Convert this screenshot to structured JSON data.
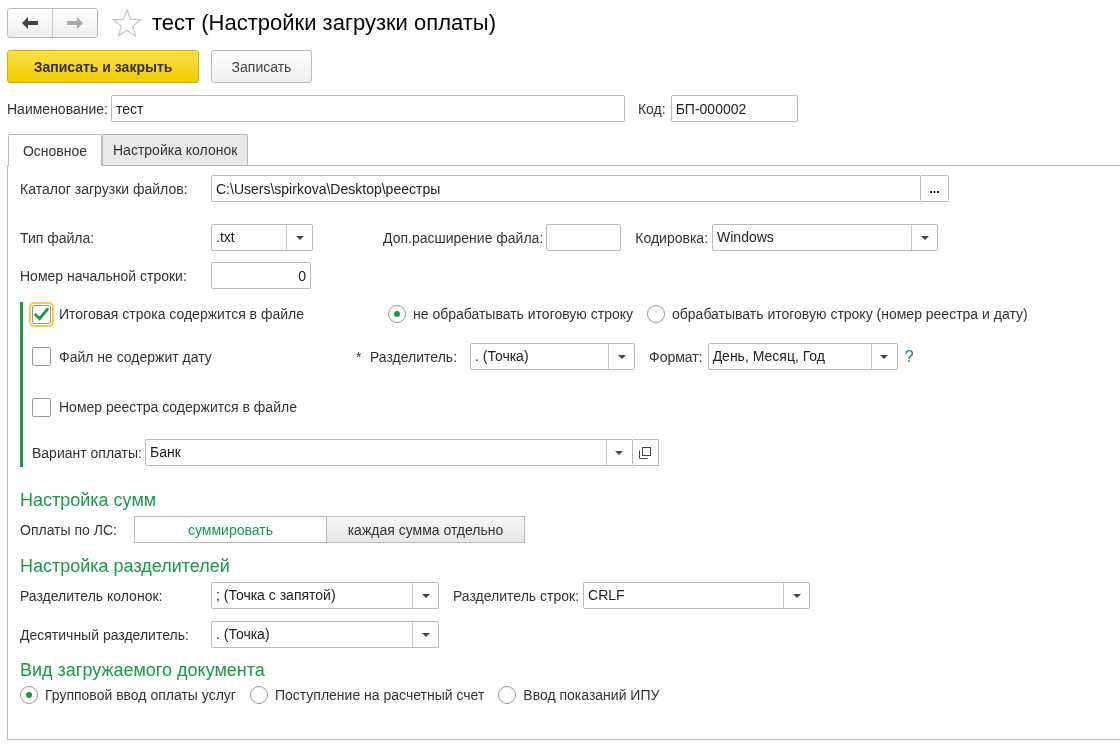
{
  "nav_buttons": [
    {
      "kind": "back",
      "disabled": false
    },
    {
      "kind": "forward",
      "disabled": true
    }
  ],
  "favorite": false,
  "window": {
    "title": "тест (Настройки загрузки оплаты)"
  },
  "toolbar": [
    {
      "label": "Записать и закрыть",
      "kind": "primary"
    },
    {
      "label": "Записать",
      "kind": "normal"
    }
  ],
  "header": {
    "name": {
      "label": "Наименование:",
      "value": "тест"
    },
    "code": {
      "label": "Код:",
      "value": "БП-000002"
    }
  },
  "tabs": [
    {
      "label": "Основное",
      "selected": true
    },
    {
      "label": "Настройка колонок",
      "selected": false
    }
  ],
  "main": {
    "catalog": {
      "label": "Каталог загрузки файлов:",
      "value": "C:\\Users\\spirkova\\Desktop\\реестры",
      "button": "..."
    },
    "file_type": {
      "label": "Тип файла:",
      "value": ".txt"
    },
    "extra_extension": {
      "label": "Доп.расширение файла:"
    },
    "encoding": {
      "label": "Кодировка:",
      "value": "Windows"
    },
    "start_row": {
      "label": "Номер начальной строки:",
      "value": "0"
    },
    "total_line": {
      "label": "Итоговая строка содержится в файле",
      "checked": true,
      "focused": true
    },
    "total_modes": [
      {
        "label": "не обрабатывать итоговую строку",
        "selected": true
      },
      {
        "label": "обрабатывать итоговую строку (номер реестра и дату)",
        "selected": false
      }
    ],
    "no_date": {
      "label": "Файл не содержит дату",
      "checked": false
    },
    "date_separator": {
      "required_mark": "*",
      "label": "Разделитель:",
      "value": ". (Точка)"
    },
    "date_format": {
      "label": "Формат:",
      "value": "День, Месяц, Год",
      "help": "?"
    },
    "registry_number": {
      "label": "Номер реестра содержится в файле",
      "checked": false
    },
    "payment_variant": {
      "label": "Вариант оплаты:",
      "value": "Банк"
    }
  },
  "sums": {
    "title": "Настройка сумм",
    "label": "Оплаты по ЛС:",
    "options": [
      {
        "label": "суммировать",
        "selected": true
      },
      {
        "label": "каждая сумма отдельно",
        "selected": false
      }
    ]
  },
  "separators": {
    "title": "Настройка разделителей",
    "column": {
      "label": "Разделитель колонок:",
      "value": "; (Точка с запятой)"
    },
    "row": {
      "label": "Разделитель строк:",
      "value": "CRLF"
    },
    "decimal": {
      "label": "Десятичный разделитель:",
      "value": ". (Точка)"
    }
  },
  "document_type": {
    "title": "Вид загружаемого документа",
    "options": [
      {
        "label": "Групповой ввод оплаты услуг",
        "selected": true
      },
      {
        "label": "Поступление на расчетный счет",
        "selected": false
      },
      {
        "label": "Ввод показаний ИПУ",
        "selected": false
      }
    ]
  }
}
